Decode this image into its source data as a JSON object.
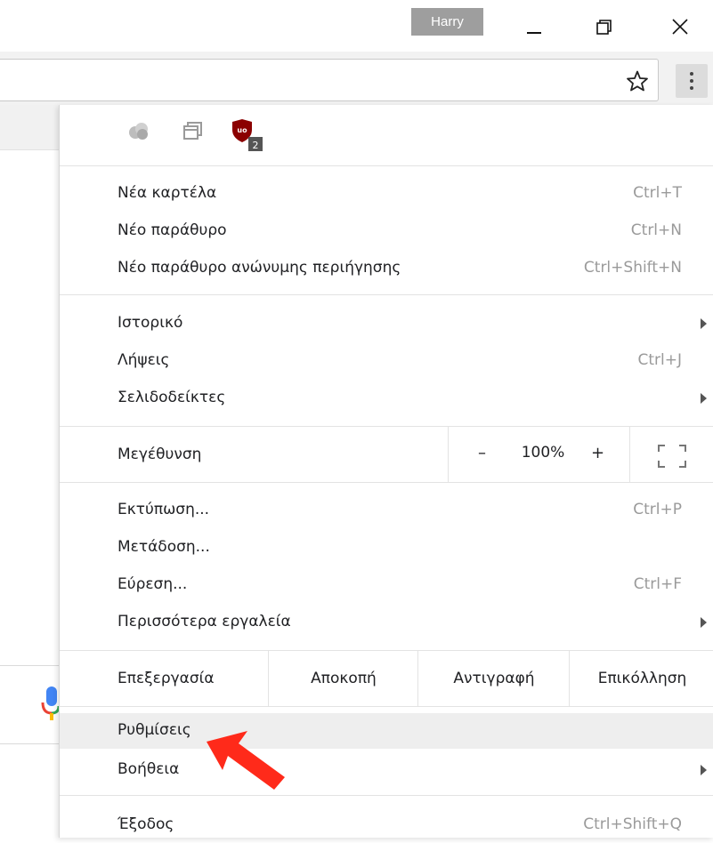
{
  "window": {
    "profile_name": "Harry"
  },
  "extensions": [
    {
      "name": "cloud-extension-icon"
    },
    {
      "name": "tabs-extension-icon"
    },
    {
      "name": "ublock-origin-icon",
      "badge": "2",
      "color": "#8b0000"
    }
  ],
  "menu": {
    "group1": [
      {
        "label": "Νέα καρτέλα",
        "shortcut": "Ctrl+T"
      },
      {
        "label": "Νέο παράθυρο",
        "shortcut": "Ctrl+N"
      },
      {
        "label": "Νέο παράθυρο ανώνυμης περιήγησης",
        "shortcut": "Ctrl+Shift+N"
      }
    ],
    "group2": [
      {
        "label": "Ιστορικό"
      },
      {
        "label": "Λήψεις",
        "shortcut": "Ctrl+J"
      },
      {
        "label": "Σελιδοδείκτες"
      }
    ],
    "zoom": {
      "label": "Μεγέθυνση",
      "minus": "–",
      "value": "100%",
      "plus": "+"
    },
    "group3": [
      {
        "label": "Εκτύπωση...",
        "shortcut": "Ctrl+P"
      },
      {
        "label": "Μετάδοση..."
      },
      {
        "label": "Εύρεση...",
        "shortcut": "Ctrl+F"
      },
      {
        "label": "Περισσότερα εργαλεία"
      }
    ],
    "edit": {
      "label": "Επεξεργασία",
      "cut": "Αποκοπή",
      "copy": "Αντιγραφή",
      "paste": "Επικόλληση"
    },
    "group4": [
      {
        "label": "Ρυθμίσεις"
      },
      {
        "label": "Βοήθεια"
      }
    ],
    "exit": {
      "label": "Έξοδος",
      "shortcut": "Ctrl+Shift+Q"
    }
  },
  "colors": {
    "highlight": "#eeeeee",
    "pointer_arrow": "#ff2a1a",
    "ublock": "#8b0000"
  }
}
